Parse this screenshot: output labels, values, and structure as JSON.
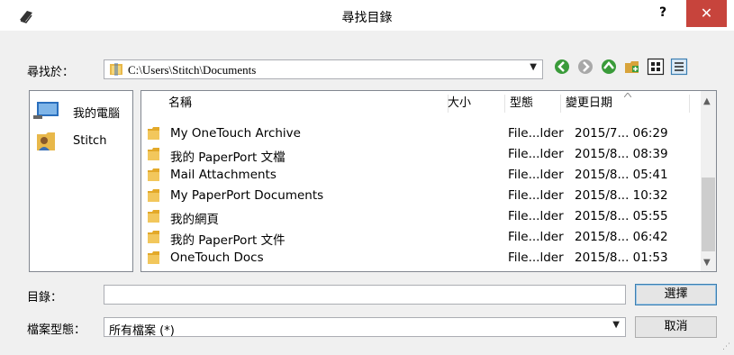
{
  "window": {
    "title": "尋找目錄",
    "help_label": "?",
    "close_label": "✕",
    "icon": "scanner-icon"
  },
  "look_in": {
    "label": "尋找於：",
    "path": "C:\\Users\\Stitch\\Documents"
  },
  "toolbar": {
    "icons": [
      "back-arrow-icon",
      "forward-arrow-icon",
      "up-folder-icon",
      "new-folder-icon",
      "list-view-icon",
      "details-view-icon"
    ]
  },
  "places": [
    {
      "label": "我的電腦",
      "icon": "computer-icon"
    },
    {
      "label": "Stitch",
      "icon": "user-folder-icon"
    }
  ],
  "columns": {
    "name": "名稱",
    "size": "大小",
    "type": "型態",
    "modified": "變更日期"
  },
  "files": [
    {
      "name": "My OneTouch Archive",
      "type": "File...lder",
      "date": "2015/7... 06:29"
    },
    {
      "name": "我的 PaperPort 文檔",
      "type": "File...lder",
      "date": "2015/8... 08:39"
    },
    {
      "name": "Mail Attachments",
      "type": "File...lder",
      "date": "2015/8... 05:41"
    },
    {
      "name": "My PaperPort Documents",
      "type": "File...lder",
      "date": "2015/8... 10:32"
    },
    {
      "name": "我的網頁",
      "type": "File...lder",
      "date": "2015/8... 05:55"
    },
    {
      "name": "我的 PaperPort 文件",
      "type": "File...lder",
      "date": "2015/8... 06:42"
    },
    {
      "name": "OneTouch Docs",
      "type": "File...lder",
      "date": "2015/8... 01:53"
    }
  ],
  "directory": {
    "label": "目錄：",
    "value": "",
    "choose_button": "選擇"
  },
  "file_type": {
    "label": "檔案型態：",
    "value": "所有檔案 (*)",
    "cancel_button": "取消"
  }
}
